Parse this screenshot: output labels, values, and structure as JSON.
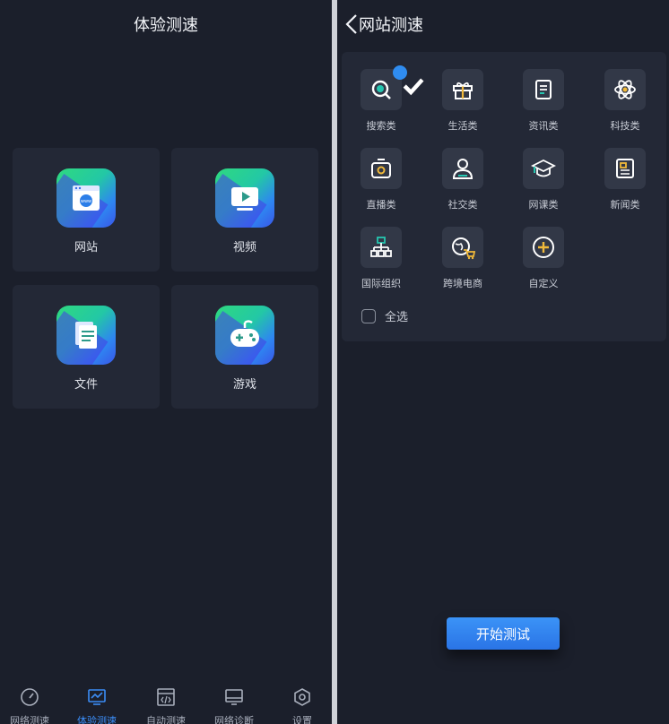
{
  "left": {
    "title": "体验测速",
    "tiles": [
      {
        "label": "网站",
        "icon": "browser-www-icon"
      },
      {
        "label": "视频",
        "icon": "video-play-icon"
      },
      {
        "label": "文件",
        "icon": "document-icon"
      },
      {
        "label": "游戏",
        "icon": "gamepad-icon"
      }
    ],
    "tabs": [
      {
        "label": "网络测速",
        "icon": "speedometer-icon",
        "active": false
      },
      {
        "label": "体验测速",
        "icon": "monitor-chart-icon",
        "active": true
      },
      {
        "label": "自动测速",
        "icon": "code-window-icon",
        "active": false
      },
      {
        "label": "网络诊断",
        "icon": "monitor-icon",
        "active": false
      },
      {
        "label": "设置",
        "icon": "settings-hexagon-icon",
        "active": false
      }
    ]
  },
  "right": {
    "title": "网站测速",
    "categories": [
      {
        "label": "搜索类",
        "icon": "search-icon",
        "checked": true
      },
      {
        "label": "生活类",
        "icon": "gift-icon",
        "checked": false
      },
      {
        "label": "资讯类",
        "icon": "news-doc-icon",
        "checked": false
      },
      {
        "label": "科技类",
        "icon": "atom-icon",
        "checked": false
      },
      {
        "label": "直播类",
        "icon": "live-camera-icon",
        "checked": false
      },
      {
        "label": "社交类",
        "icon": "user-chat-icon",
        "checked": false
      },
      {
        "label": "网课类",
        "icon": "graduation-cap-icon",
        "checked": false
      },
      {
        "label": "新闻类",
        "icon": "newspaper-icon",
        "checked": false
      },
      {
        "label": "国际组织",
        "icon": "org-chart-icon",
        "checked": false
      },
      {
        "label": "跨境电商",
        "icon": "globe-cart-icon",
        "checked": false
      },
      {
        "label": "自定义",
        "icon": "plus-circle-icon",
        "checked": false
      }
    ],
    "select_all_label": "全选",
    "start_button": "开始测试"
  },
  "colors": {
    "background": "#1b1f2b",
    "card": "#232836",
    "accent": "#3b8cf5",
    "icon_yellow": "#f0b93a",
    "icon_teal": "#26c6b0"
  }
}
